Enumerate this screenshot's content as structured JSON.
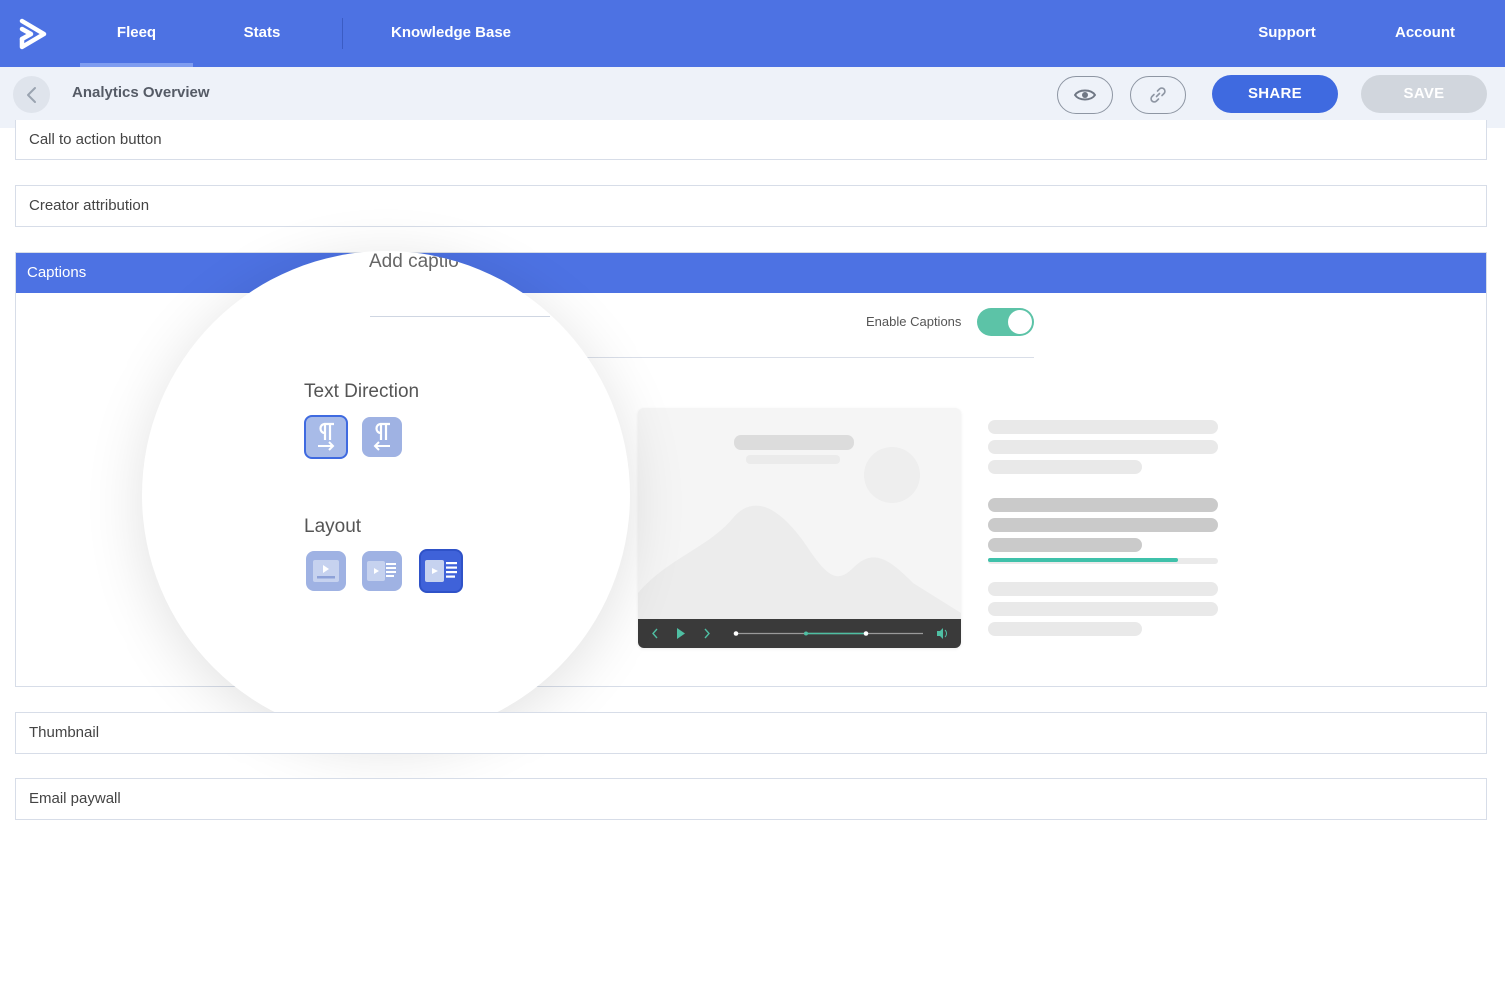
{
  "nav": {
    "items": [
      {
        "label": "Fleeq"
      },
      {
        "label": "Stats"
      },
      {
        "label": "Knowledge Base"
      },
      {
        "label": "Support"
      },
      {
        "label": "Account"
      }
    ]
  },
  "subheader": {
    "title": "Analytics Overview",
    "share_label": "SHARE",
    "save_label": "SAVE"
  },
  "sections": {
    "cta": "Call to action button",
    "creator": "Creator attribution",
    "captions": "Captions",
    "thumbnail": "Thumbnail",
    "paywall": "Email paywall"
  },
  "captions": {
    "add_caption_text": "Add captio",
    "enable_label": "Enable Captions",
    "enabled": true,
    "text_direction_label": "Text Direction",
    "layout_label": "Layout"
  },
  "colors": {
    "brand": "#4d72e3",
    "accent": "#5cc3a7",
    "share": "#3f6ae0"
  }
}
